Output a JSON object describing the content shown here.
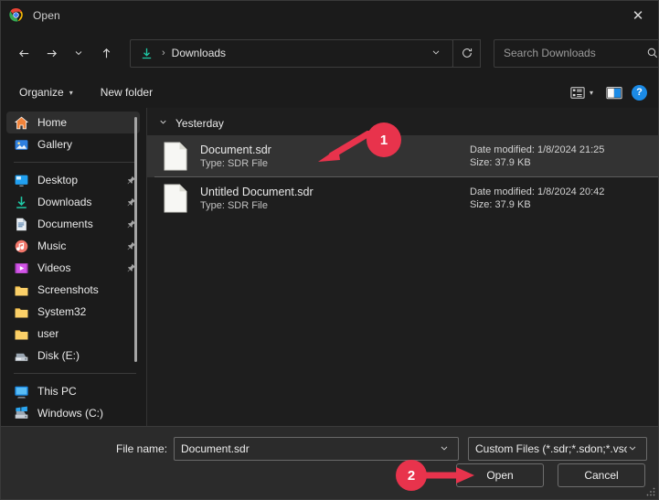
{
  "window": {
    "title": "Open",
    "app_icon": "chrome-icon",
    "close_label": "✕"
  },
  "nav": {
    "back_icon": "arrow-left-icon",
    "forward_icon": "arrow-right-icon",
    "recent_icon": "chevron-down-icon",
    "up_icon": "arrow-up-icon",
    "breadcrumb": {
      "folder_icon": "downloads-arrow-icon",
      "separator": "›",
      "path": "Downloads",
      "dropdown_icon": "chevron-down-icon",
      "icon_color": "#1fc9a6"
    },
    "refresh_icon": "refresh-icon",
    "search": {
      "placeholder": "Search Downloads",
      "value": "",
      "icon": "search-icon"
    }
  },
  "command_bar": {
    "organize_label": "Organize",
    "organize_caret": "▾",
    "new_folder_label": "New folder",
    "view_icon": "view-details-icon",
    "view_caret": "▾",
    "preview_pane_icon": "preview-pane-icon",
    "help_icon": "help-icon",
    "help_glyph": "?",
    "help_color": "#1b8ae5"
  },
  "sidebar": {
    "items": [
      {
        "label": "Home",
        "icon": "home-icon",
        "pinned": false,
        "selected": true,
        "separator_after": false
      },
      {
        "label": "Gallery",
        "icon": "gallery-icon",
        "pinned": false,
        "selected": false,
        "separator_after": true
      },
      {
        "label": "Desktop",
        "icon": "desktop-icon",
        "pinned": true,
        "selected": false,
        "separator_after": false
      },
      {
        "label": "Downloads",
        "icon": "downloads-icon",
        "pinned": true,
        "selected": false,
        "separator_after": false
      },
      {
        "label": "Documents",
        "icon": "documents-icon",
        "pinned": true,
        "selected": false,
        "separator_after": false
      },
      {
        "label": "Music",
        "icon": "music-icon",
        "pinned": true,
        "selected": false,
        "separator_after": false
      },
      {
        "label": "Videos",
        "icon": "videos-icon",
        "pinned": true,
        "selected": false,
        "separator_after": false
      },
      {
        "label": "Screenshots",
        "icon": "folder-icon",
        "pinned": false,
        "selected": false,
        "separator_after": false
      },
      {
        "label": "System32",
        "icon": "folder-icon",
        "pinned": false,
        "selected": false,
        "separator_after": false
      },
      {
        "label": "user",
        "icon": "folder-icon",
        "pinned": false,
        "selected": false,
        "separator_after": false
      },
      {
        "label": "Disk (E:)",
        "icon": "drive-icon",
        "pinned": false,
        "selected": false,
        "separator_after": true
      },
      {
        "label": "This PC",
        "icon": "this-pc-icon",
        "pinned": false,
        "selected": false,
        "separator_after": false
      },
      {
        "label": "Windows (C:)",
        "icon": "windows-drive-icon",
        "pinned": false,
        "selected": false,
        "separator_after": false
      }
    ]
  },
  "file_list": {
    "group_header": "Yesterday",
    "group_chevron": "⌄",
    "date_label": "Date modified:",
    "size_label": "Size:",
    "rows": [
      {
        "name": "Document.sdr",
        "type": "Type: SDR File",
        "date_modified": "Date modified: 1/8/2024 21:25",
        "size": "Size: 37.9 KB",
        "selected": true,
        "icon": "file-icon"
      },
      {
        "name": "Untitled Document.sdr",
        "type": "Type: SDR File",
        "date_modified": "Date modified: 1/8/2024 20:42",
        "size": "Size: 37.9 KB",
        "selected": false,
        "icon": "file-icon"
      }
    ]
  },
  "footer": {
    "file_name_label": "File name:",
    "file_name_value": "Document.sdr",
    "file_name_chevron": "⌄",
    "file_type_value": "Custom Files (*.sdr;*.sdon;*.vso",
    "file_type_chevron": "⌄",
    "open_label": "Open",
    "cancel_label": "Cancel",
    "resize_grip_icon": "resize-grip-icon"
  },
  "annotations": {
    "badge_color": "#e8334c",
    "markers": [
      {
        "number": "1",
        "target": "Document.sdr file row"
      },
      {
        "number": "2",
        "target": "Open button"
      }
    ]
  }
}
